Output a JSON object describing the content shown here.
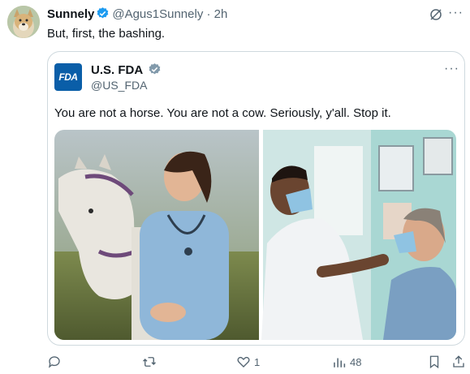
{
  "tweet": {
    "author_name": "Sunnely",
    "author_handle": "@Agus1Sunnely",
    "separator": "·",
    "time": "2h",
    "text": "But, first, the bashing.",
    "avatar_icon": "dog-avatar"
  },
  "quoted_tweet": {
    "author_name": "U.S. FDA",
    "author_handle": "@US_FDA",
    "logo_text": "FDA",
    "text": "You are not a horse. You are not a cow. Seriously, y'all. Stop it.",
    "media_icon": "photo-collage-vet-horse-doctor-patient"
  },
  "actions": {
    "reply_count": "",
    "retweet_count": "",
    "like_count": "1",
    "view_count": "48"
  },
  "colors": {
    "verified_blue": "#1d9bf0",
    "verified_gray": "#829aab",
    "muted_text": "#536471",
    "fda_blue": "#0a5ea8"
  }
}
